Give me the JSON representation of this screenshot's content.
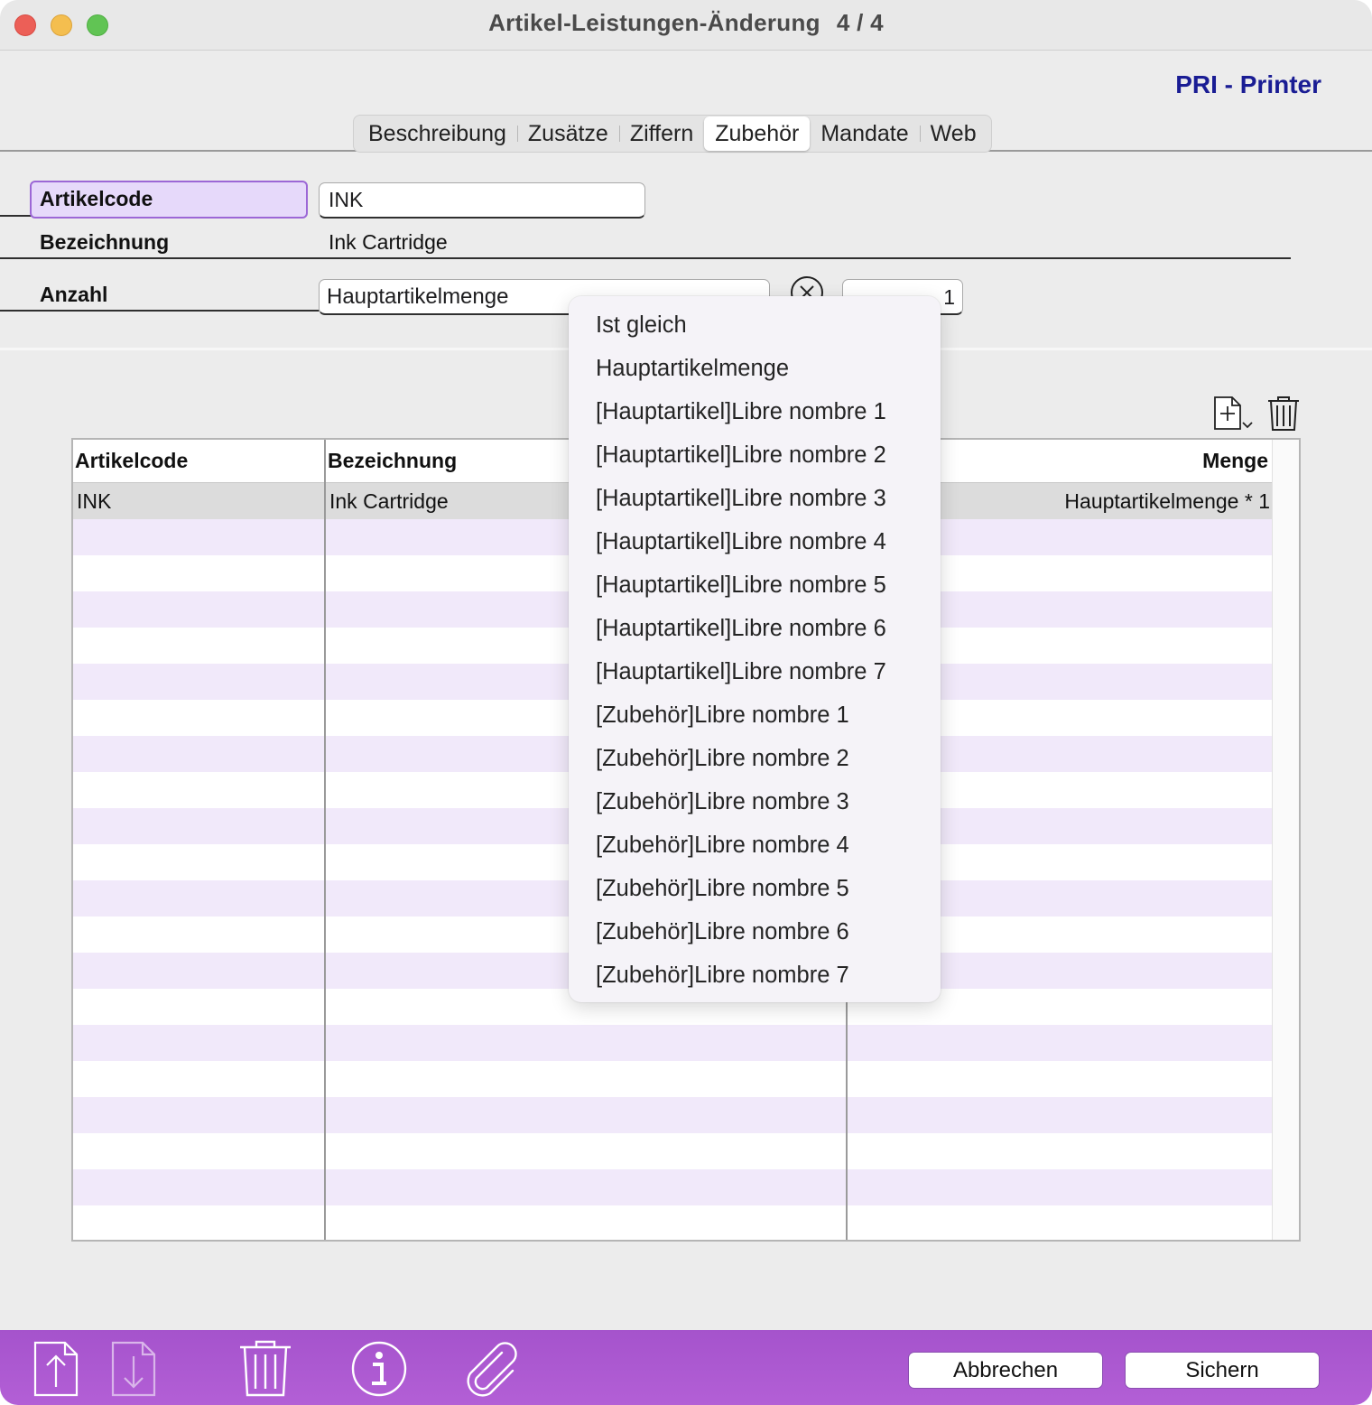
{
  "window": {
    "title": "Artikel-Leistungen-Änderung",
    "page_indicator": "4 / 4"
  },
  "brand": "PRI - Printer",
  "tabs": [
    {
      "label": "Beschreibung",
      "active": false
    },
    {
      "label": "Zusätze",
      "active": false
    },
    {
      "label": "Ziffern",
      "active": false
    },
    {
      "label": "Zubehör",
      "active": true
    },
    {
      "label": "Mandate",
      "active": false
    },
    {
      "label": "Web",
      "active": false
    }
  ],
  "form": {
    "artikelcode_label": "Artikelcode",
    "artikelcode_value": "INK",
    "bezeichnung_label": "Bezeichnung",
    "bezeichnung_value": "Ink Cartridge",
    "anzahl_label": "Anzahl",
    "anzahl_select_value": "Hauptartikelmenge",
    "anzahl_number_value": "1"
  },
  "table": {
    "columns": [
      "Artikelcode",
      "Bezeichnung",
      "Menge"
    ],
    "rows": [
      {
        "artikelcode": "INK",
        "bezeichnung": "Ink Cartridge",
        "menge": "Hauptartikelmenge * 1"
      }
    ]
  },
  "dropdown": {
    "items": [
      "Ist gleich",
      "Hauptartikelmenge",
      "[Hauptartikel]Libre nombre 1",
      "[Hauptartikel]Libre nombre 2",
      "[Hauptartikel]Libre nombre 3",
      "[Hauptartikel]Libre nombre 4",
      "[Hauptartikel]Libre nombre 5",
      "[Hauptartikel]Libre nombre 6",
      "[Hauptartikel]Libre nombre 7",
      "[Zubehör]Libre nombre 1",
      "[Zubehör]Libre nombre 2",
      "[Zubehör]Libre nombre 3",
      "[Zubehör]Libre nombre 4",
      "[Zubehör]Libre nombre 5",
      "[Zubehör]Libre nombre 6",
      "[Zubehör]Libre nombre 7"
    ]
  },
  "footer": {
    "cancel_label": "Abbrechen",
    "save_label": "Sichern",
    "icons": [
      "export-icon",
      "import-icon",
      "trash-icon",
      "info-icon",
      "paperclip-icon"
    ]
  },
  "colors": {
    "brand": "#1a1d94",
    "accent_purple": "#b35fd6",
    "row_alt": "#f1e9fa",
    "label_highlight": "#e6d9fa"
  }
}
